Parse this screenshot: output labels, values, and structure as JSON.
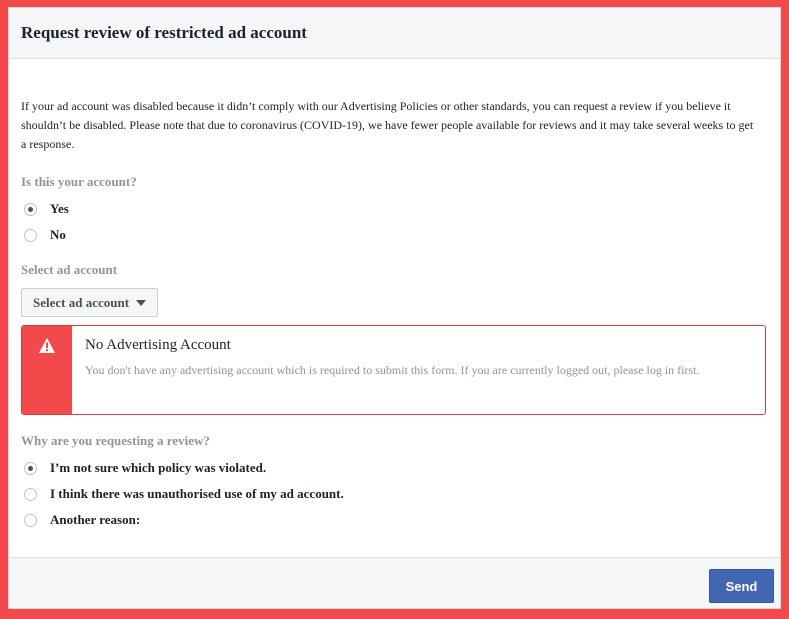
{
  "header": {
    "title": "Request review of restricted ad account"
  },
  "intro": "If your ad account was disabled because it didn’t comply with our Advertising Policies or other standards, you can request a review if you believe it shouldn’t be disabled. Please note that due to coronavirus (COVID-19), we have fewer people available for reviews and it may take several weeks to get a response.",
  "account_question": {
    "label": "Is this your account?",
    "options": [
      {
        "label": "Yes",
        "checked": true
      },
      {
        "label": "No",
        "checked": false
      }
    ]
  },
  "select_account": {
    "label": "Select ad account",
    "button_label": "Select ad account"
  },
  "alert": {
    "title": "No Advertising Account",
    "text": "You don't have any advertising account which is required to submit this form. If you are currently logged out, please log in first.",
    "icon": "warning-icon",
    "color": "#f24a4a"
  },
  "review_question": {
    "label": "Why are you requesting a review?",
    "options": [
      {
        "label": "I’m not sure which policy was violated.",
        "checked": true
      },
      {
        "label": "I think there was unauthorised use of my ad account.",
        "checked": false
      },
      {
        "label": "Another reason:",
        "checked": false
      }
    ]
  },
  "footer": {
    "send_label": "Send"
  },
  "colors": {
    "accent": "#4267b2",
    "alert": "#f24a4a",
    "muted": "#90949c"
  }
}
